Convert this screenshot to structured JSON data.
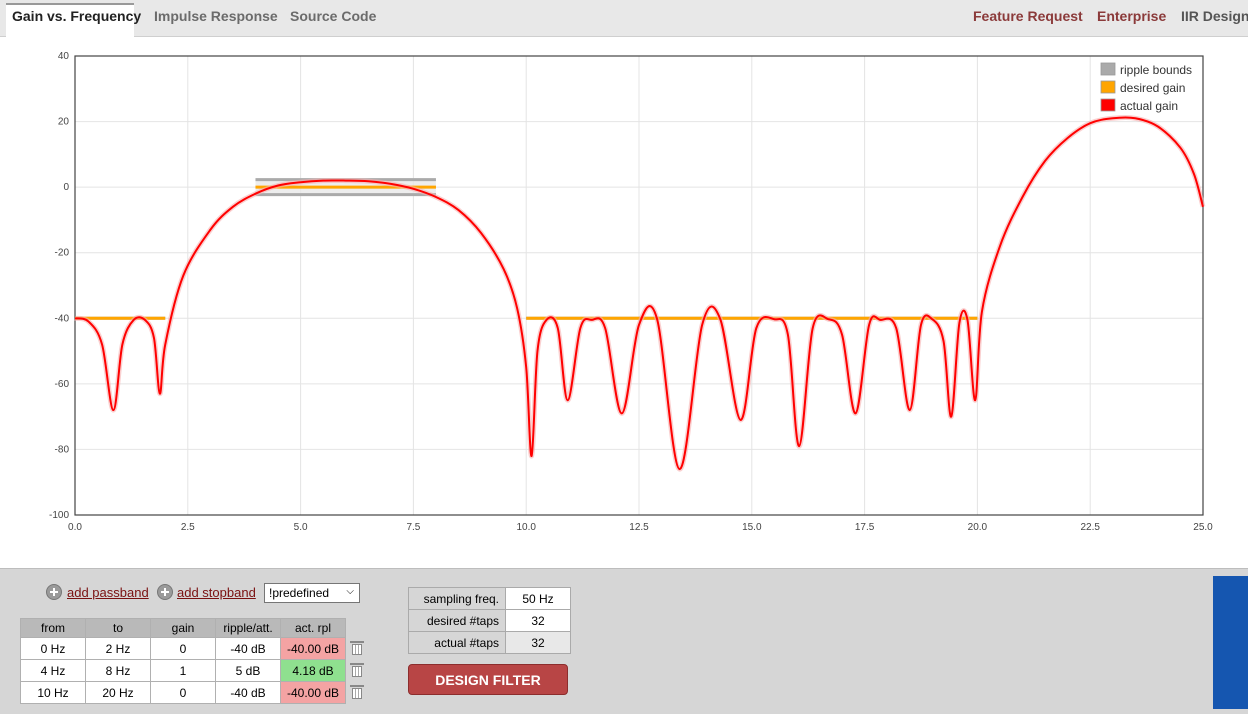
{
  "nav": {
    "tabs": [
      "Gain vs. Frequency",
      "Impulse Response",
      "Source Code"
    ],
    "right_links": [
      "Feature Request",
      "Enterprise",
      "IIR Design"
    ]
  },
  "colors": {
    "ripple": "#aaaaaa",
    "desired": "#ffa500",
    "actual": "#ff0000",
    "link": "#7a1010",
    "button": "#b84545"
  },
  "chart_data": {
    "type": "line",
    "xlim": [
      0,
      25
    ],
    "ylim": [
      -100,
      40
    ],
    "x_ticks": [
      "0.0",
      "2.5",
      "5.0",
      "7.5",
      "10.0",
      "12.5",
      "15.0",
      "17.5",
      "20.0",
      "22.5",
      "25.0"
    ],
    "y_ticks": [
      "40",
      "20",
      "0",
      "-20",
      "-40",
      "-60",
      "-80",
      "-100"
    ],
    "legend": {
      "position": "top-right",
      "items": [
        "ripple bounds",
        "desired gain",
        "actual gain"
      ]
    },
    "grid": true,
    "series": [
      {
        "name": "ripple bounds",
        "segments": [
          {
            "x": [
              0,
              2
            ],
            "upper": -40,
            "lower": -40
          },
          {
            "x": [
              4,
              8
            ],
            "upper": 2.3,
            "lower": -2.3
          },
          {
            "x": [
              10,
              20
            ],
            "upper": -40,
            "lower": -40
          }
        ]
      },
      {
        "name": "desired gain",
        "segments": [
          {
            "x": [
              0,
              2
            ],
            "y": -40
          },
          {
            "x": [
              4,
              8
            ],
            "y": 0
          },
          {
            "x": [
              10,
              20
            ],
            "y": -40
          }
        ]
      },
      {
        "name": "actual gain",
        "x": [
          0,
          0.3,
          0.6,
          0.85,
          1.05,
          1.3,
          1.55,
          1.75,
          1.88,
          2.0,
          2.4,
          3.0,
          3.5,
          4.0,
          4.5,
          5.0,
          5.5,
          6.0,
          6.5,
          7.0,
          7.5,
          8.0,
          8.5,
          9.0,
          9.5,
          9.8,
          10.0,
          10.12,
          10.25,
          10.45,
          10.7,
          10.92,
          11.2,
          11.45,
          11.75,
          12.12,
          12.5,
          12.9,
          13.4,
          13.9,
          14.3,
          14.75,
          15.1,
          15.5,
          15.8,
          16.05,
          16.35,
          16.7,
          17.0,
          17.3,
          17.6,
          17.85,
          18.2,
          18.5,
          18.75,
          19.0,
          19.25,
          19.42,
          19.6,
          19.78,
          19.95,
          20.1,
          20.5,
          21.0,
          21.5,
          22.0,
          22.5,
          23.0,
          23.5,
          24.0,
          24.5,
          24.8,
          25.0
        ],
        "y": [
          -40,
          -41,
          -48,
          -68,
          -48,
          -40.5,
          -40.5,
          -46,
          -63,
          -48,
          -27,
          -13,
          -6,
          -2,
          0.5,
          1.5,
          2,
          2,
          1.8,
          1,
          -0.5,
          -3,
          -7,
          -14,
          -25,
          -37,
          -55,
          -82,
          -50,
          -40.5,
          -43,
          -65,
          -43,
          -40.5,
          -43,
          -69,
          -42,
          -40.2,
          -86,
          -42,
          -40.2,
          -71,
          -43,
          -40.3,
          -45,
          -79,
          -43,
          -40.3,
          -45,
          -69,
          -42,
          -40.5,
          -43,
          -68,
          -42,
          -40.3,
          -47,
          -70,
          -41.5,
          -40.5,
          -65,
          -38,
          -18,
          -3,
          8,
          15,
          19.5,
          21,
          21,
          18.5,
          12,
          4,
          -6
        ]
      }
    ]
  },
  "controls": {
    "add_passband": "add passband",
    "add_stopband": "add stopband",
    "predefined": "!predefined"
  },
  "bands": {
    "headers": [
      "from",
      "to",
      "gain",
      "ripple/att.",
      "act. rpl"
    ],
    "rows": [
      {
        "from": "0 Hz",
        "to": "2 Hz",
        "gain": "0",
        "ripple": "-40 dB",
        "act": "-40.00 dB",
        "status": "red"
      },
      {
        "from": "4 Hz",
        "to": "8 Hz",
        "gain": "1",
        "ripple": "5 dB",
        "act": "4.18 dB",
        "status": "green"
      },
      {
        "from": "10 Hz",
        "to": "20 Hz",
        "gain": "0",
        "ripple": "-40 dB",
        "act": "-40.00 dB",
        "status": "red"
      }
    ]
  },
  "params": {
    "sampling_label": "sampling freq.",
    "sampling_value": "50 Hz",
    "desired_label": "desired #taps",
    "desired_value": "32",
    "actual_label": "actual #taps",
    "actual_value": "32"
  },
  "design_button": "DESIGN FILTER"
}
